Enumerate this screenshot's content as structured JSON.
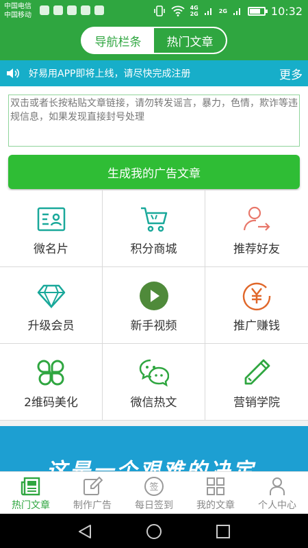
{
  "status_bar": {
    "carrier_1": "中国电信",
    "carrier_2": "中国移动",
    "net_top": "4G",
    "net_bottom": "2G",
    "net2_top": "2G",
    "time": "10:32"
  },
  "header": {
    "tab_nav": "导航栏条",
    "tab_hot": "热门文章"
  },
  "notice": {
    "text": "好易用APP即将上线，请尽快完成注册",
    "more": "更多"
  },
  "input": {
    "placeholder": "双击或者长按粘贴文章链接，请勿转发谣言，暴力，色情，欺诈等违规信息，如果发现直接封号处理",
    "value": ""
  },
  "generate_button": "生成我的广告文章",
  "grid": [
    {
      "label": "微名片",
      "icon": "business-card-icon"
    },
    {
      "label": "积分商城",
      "icon": "shopping-cart-icon"
    },
    {
      "label": "推荐好友",
      "icon": "recommend-friend-icon"
    },
    {
      "label": "升级会员",
      "icon": "diamond-icon"
    },
    {
      "label": "新手视频",
      "icon": "play-video-icon"
    },
    {
      "label": "推广赚钱",
      "icon": "yen-coin-icon"
    },
    {
      "label": "2维码美化",
      "icon": "qr-beautify-icon"
    },
    {
      "label": "微信热文",
      "icon": "wechat-icon"
    },
    {
      "label": "营销学院",
      "icon": "pencil-icon"
    }
  ],
  "banner": {
    "text": "这是一个艰难的决定"
  },
  "tabbar": [
    {
      "label": "热门文章",
      "icon": "newspaper-icon",
      "active": true
    },
    {
      "label": "制作广告",
      "icon": "edit-icon",
      "active": false
    },
    {
      "label": "每日签到",
      "icon": "sign-in-icon",
      "active": false
    },
    {
      "label": "我的文章",
      "icon": "grid-icon",
      "active": false
    },
    {
      "label": "个人中心",
      "icon": "user-icon",
      "active": false
    }
  ],
  "colors": {
    "primary": "#2fa640",
    "button": "#2fbd35",
    "notice": "#17aec9",
    "banner": "#1d9fd2",
    "teal": "#19a89a",
    "coral": "#e8776a",
    "orange": "#e0672a"
  }
}
